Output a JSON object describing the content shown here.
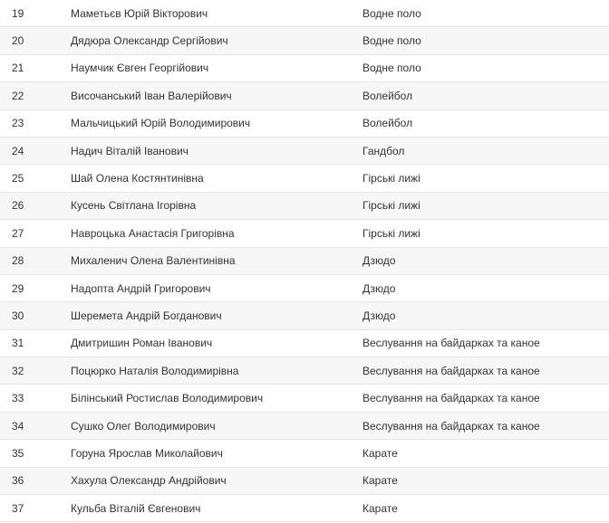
{
  "rows": [
    {
      "num": "19",
      "name": "Маметьєв Юрій Вікторович",
      "sport": "Водне поло"
    },
    {
      "num": "20",
      "name": "Дядюра Олександр Сергійович",
      "sport": "Водне поло"
    },
    {
      "num": "21",
      "name": "Наумчик Євген Георгійович",
      "sport": "Водне поло"
    },
    {
      "num": "22",
      "name": "Височанський Іван Валерійович",
      "sport": "Волейбол"
    },
    {
      "num": "23",
      "name": "Мальчицький Юрій Володимирович",
      "sport": "Волейбол"
    },
    {
      "num": "24",
      "name": "Надич Віталій Іванович",
      "sport": "Гандбол"
    },
    {
      "num": "25",
      "name": "Шай Олена Костянтинівна",
      "sport": "Гірські лижі"
    },
    {
      "num": "26",
      "name": "Кусень Світлана Ігорівна",
      "sport": "Гірські лижі"
    },
    {
      "num": "27",
      "name": "Навроцька Анастасія Григорівна",
      "sport": "Гірські лижі"
    },
    {
      "num": "28",
      "name": "Михаленич Олена Валентинівна",
      "sport": "Дзюдо"
    },
    {
      "num": "29",
      "name": "Надопта Андрій Григорович",
      "sport": "Дзюдо"
    },
    {
      "num": "30",
      "name": "Шеремета Андрій Богданович",
      "sport": "Дзюдо"
    },
    {
      "num": "31",
      "name": "Дмитришин Роман Іванович",
      "sport": "Веслування на байдарках та каное"
    },
    {
      "num": "32",
      "name": "Поцюрко Наталія Володимирівна",
      "sport": "Веслування на байдарках та каное"
    },
    {
      "num": "33",
      "name": "Білінський Ростислав Володимирович",
      "sport": "Веслування на байдарках та каное"
    },
    {
      "num": "34",
      "name": "Сушко Олег Володимирович",
      "sport": "Веслування на байдарках та каное"
    },
    {
      "num": "35",
      "name": "Горуна Ярослав Миколайович",
      "sport": "Карате"
    },
    {
      "num": "36",
      "name": "Хахула Олександр Андрійович",
      "sport": "Карате"
    },
    {
      "num": "37",
      "name": "Кульба Віталій Євгенович",
      "sport": "Карате"
    }
  ]
}
